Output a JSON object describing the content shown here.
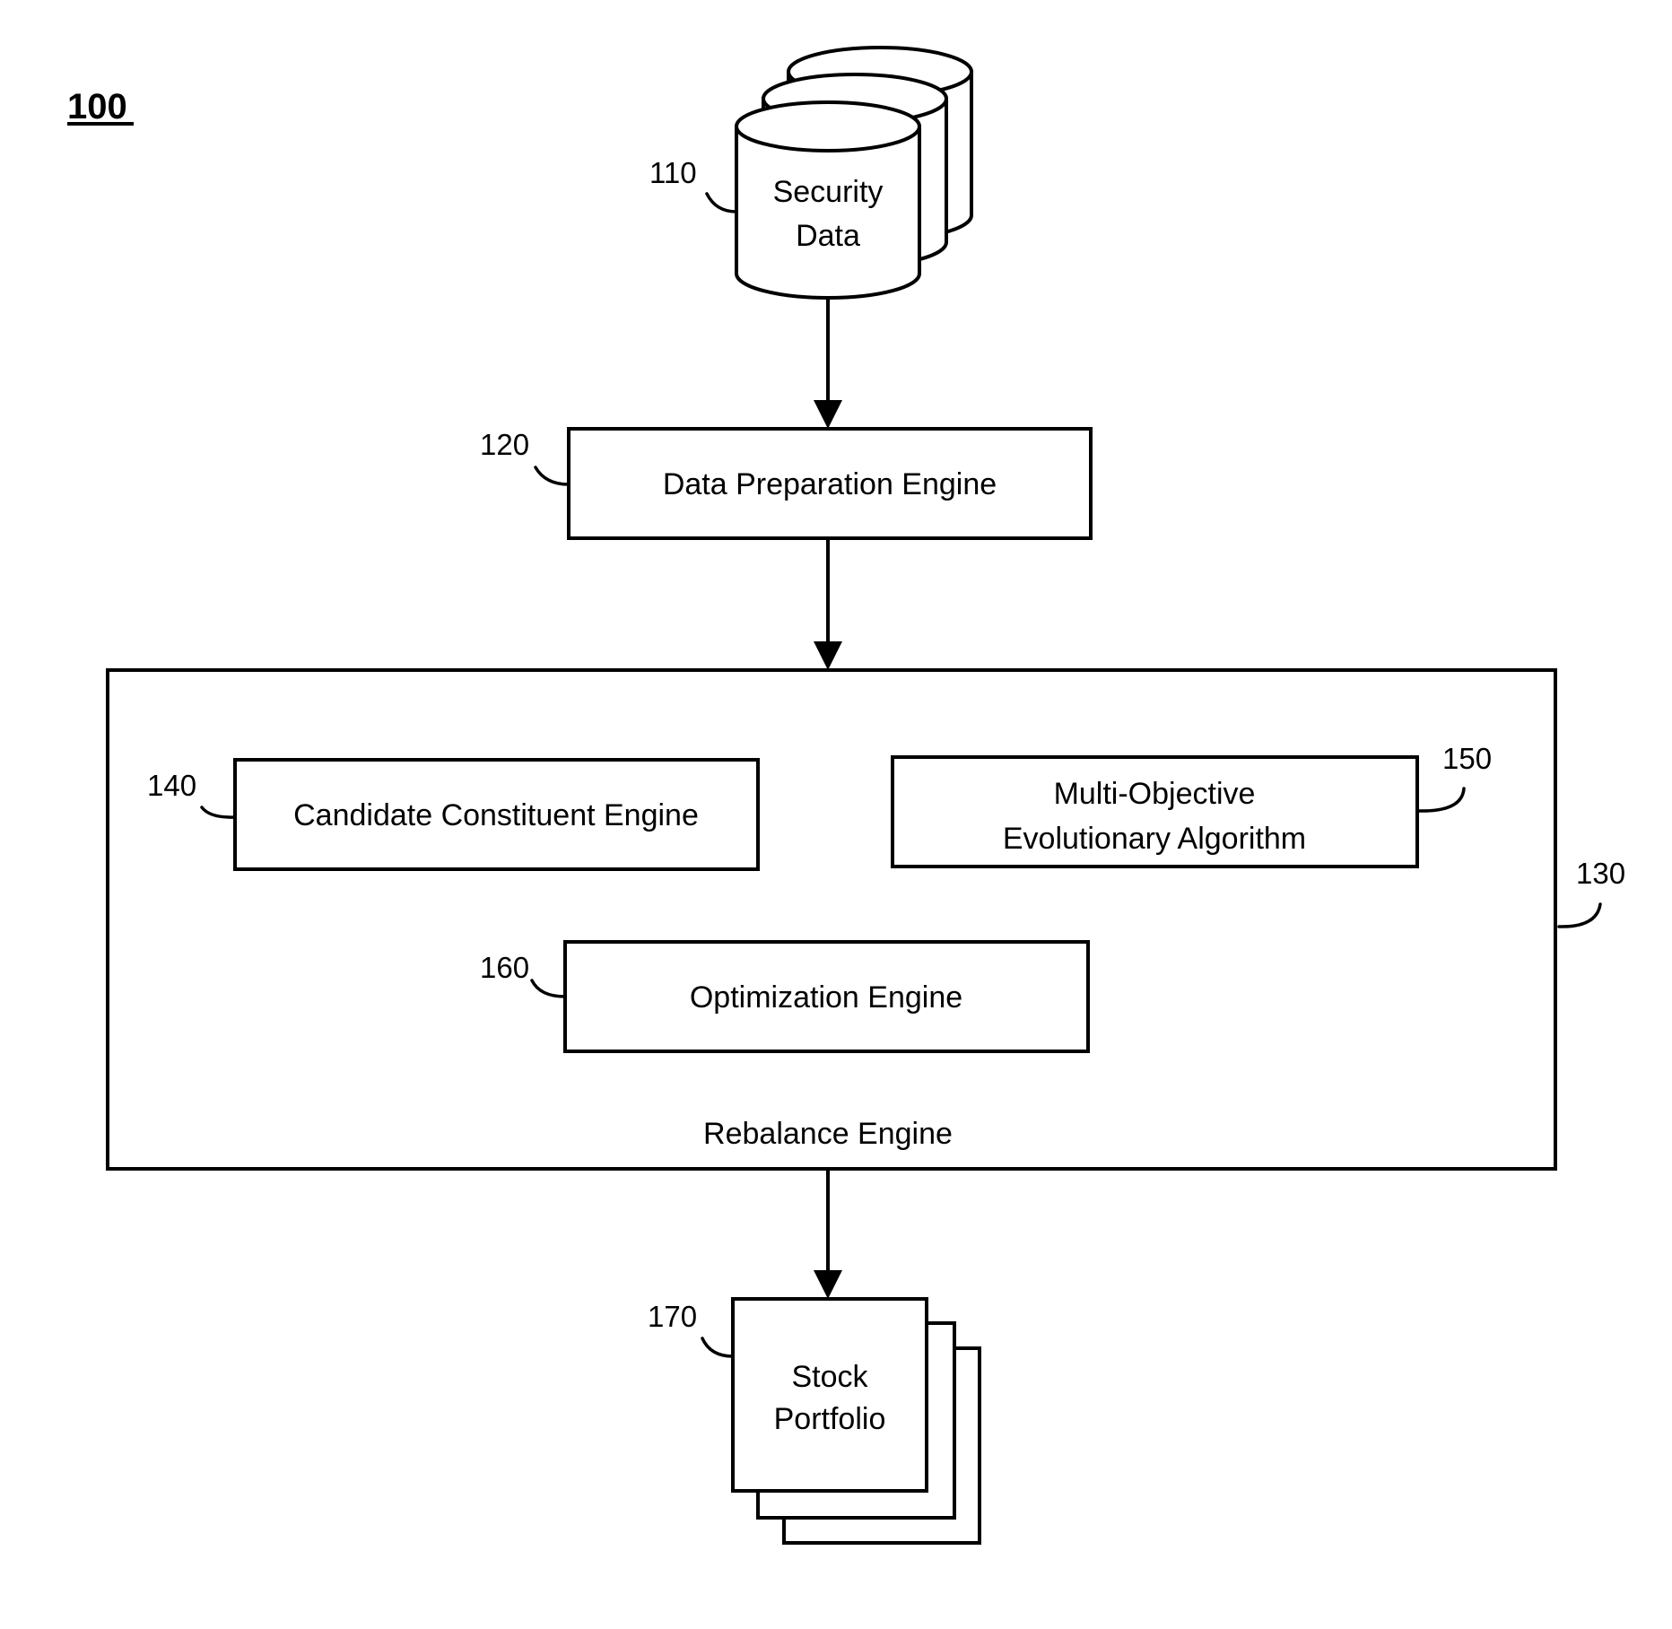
{
  "figure": {
    "number": "100"
  },
  "nodes": {
    "security_data": {
      "ref": "110",
      "lines": [
        "Security",
        "Data"
      ],
      "shape": "database-stack"
    },
    "data_preparation": {
      "ref": "120",
      "label": "Data Preparation Engine"
    },
    "rebalance_engine": {
      "ref": "130",
      "label": "Rebalance Engine"
    },
    "candidate_constituent": {
      "ref": "140",
      "label": "Candidate Constituent Engine"
    },
    "moea": {
      "ref": "150",
      "lines": [
        "Multi-Objective",
        "Evolutionary Algorithm"
      ]
    },
    "optimization": {
      "ref": "160",
      "label": "Optimization Engine"
    },
    "stock_portfolio": {
      "ref": "170",
      "lines": [
        "Stock",
        "Portfolio"
      ],
      "shape": "document-stack"
    }
  },
  "edges": [
    {
      "from": "security_data",
      "to": "data_preparation"
    },
    {
      "from": "data_preparation",
      "to": "rebalance_engine"
    },
    {
      "from": "rebalance_engine",
      "to": "stock_portfolio"
    }
  ]
}
